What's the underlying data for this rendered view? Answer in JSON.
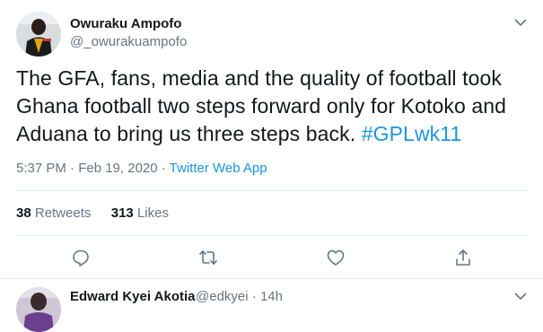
{
  "tweet": {
    "author_name": "Owuraku Ampofo",
    "author_handle": "@_owurakuampofo",
    "text": "The GFA, fans, media and the quality of football took Ghana football two steps forward only for Kotoko and Aduana to bring us three steps back.",
    "hashtag": "#GPLwk11",
    "timestamp": "5:37 PM · Feb 19, 2020",
    "separator": " · ",
    "source_app": "Twitter Web App",
    "retweets_count": "38",
    "retweets_label": "Retweets",
    "likes_count": "313",
    "likes_label": "Likes"
  },
  "actions": [
    {
      "icon": "reply-icon"
    },
    {
      "icon": "retweet-icon"
    },
    {
      "icon": "like-icon"
    },
    {
      "icon": "share-icon"
    }
  ],
  "reply": {
    "author_name": "Edward Kyei Akotia",
    "author_handle": "@edkyei",
    "time_separator": " · ",
    "time": "14h"
  },
  "colors": {
    "text": "#14171a",
    "secondary": "#657786",
    "link": "#1b95e0",
    "divider": "#e6ecf0"
  }
}
